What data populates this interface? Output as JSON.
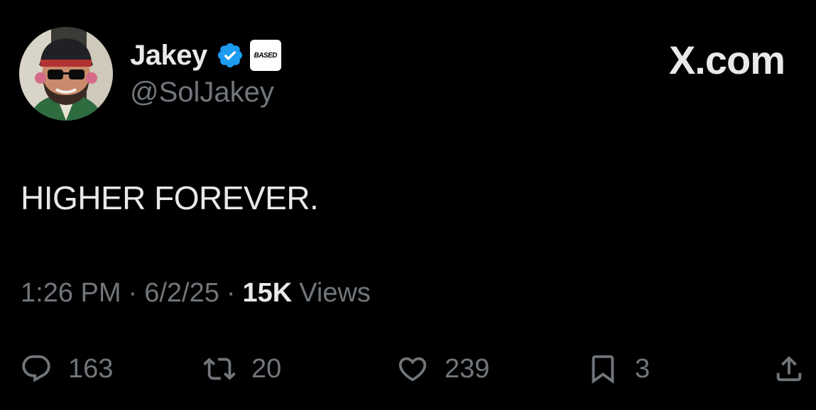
{
  "author": {
    "display_name": "Jakey",
    "handle": "@SolJakey",
    "affiliate_badge": "BASED"
  },
  "brand": {
    "label": "X.com"
  },
  "tweet": {
    "text": "HIGHER FOREVER.",
    "time": "1:26 PM",
    "date": "6/2/25",
    "separator": "·",
    "views_count": "15K",
    "views_label": "Views"
  },
  "actions": {
    "replies": "163",
    "reposts": "20",
    "likes": "239",
    "bookmarks": "3"
  },
  "colors": {
    "background": "#000000",
    "primary_text": "#e7e9ea",
    "secondary_text": "#71767b",
    "verified_blue": "#1d9bf0"
  },
  "icons": {
    "reply": "reply-icon",
    "repost": "repost-icon",
    "like": "heart-icon",
    "bookmark": "bookmark-icon",
    "share": "share-icon",
    "verified": "verified-badge-icon"
  }
}
